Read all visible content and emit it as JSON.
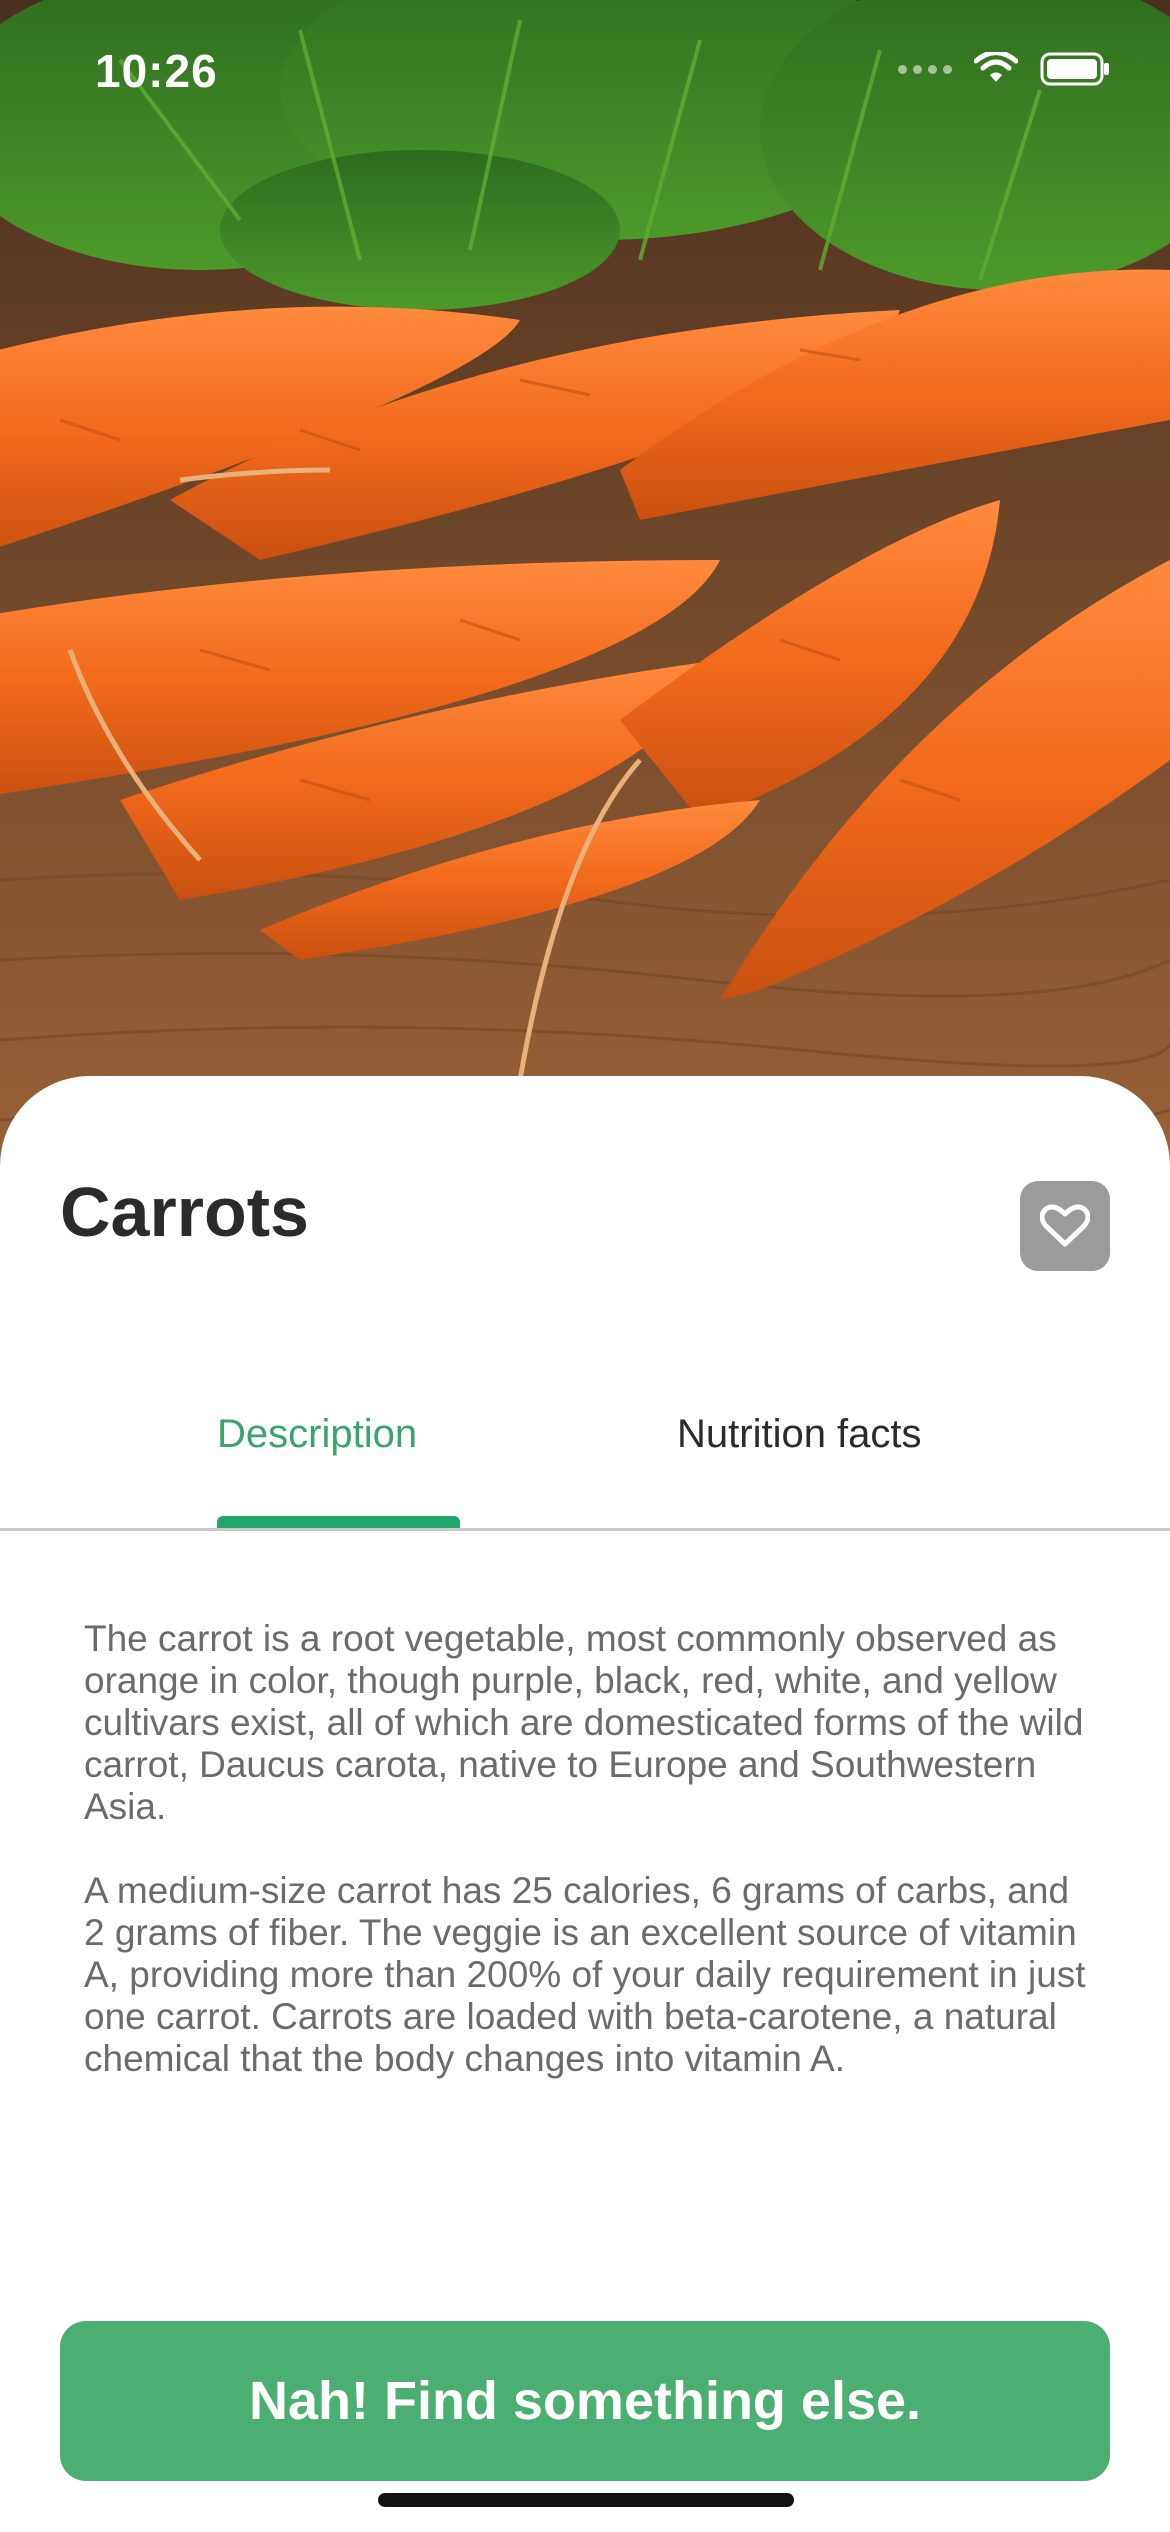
{
  "status_bar": {
    "time": "10:26"
  },
  "product": {
    "name": "Carrots",
    "favorite_icon": "heart-icon"
  },
  "tabs": [
    {
      "label": "Description",
      "active": true
    },
    {
      "label": "Nutrition facts",
      "active": false
    }
  ],
  "description": {
    "paragraphs": [
      "The carrot is a root vegetable, most commonly observed as orange in color, though purple, black, red, white, and yellow cultivars exist, all of which are domesticated forms of the wild carrot, Daucus carota, native to Europe and Southwestern Asia.",
      "A medium-size carrot has 25 calories, 6 grams of carbs, and 2 grams of fiber. The veggie is an excellent source of vitamin A, providing more than 200% of your daily requirement in just one carrot. Carrots are loaded with beta-carotene, a natural chemical that the body changes into vitamin A."
    ]
  },
  "cta": {
    "label": "Nah! Find something else."
  },
  "colors": {
    "accent_green": "#22a56b",
    "button_green": "#4caf72",
    "favorite_bg": "#9b9b9b"
  }
}
